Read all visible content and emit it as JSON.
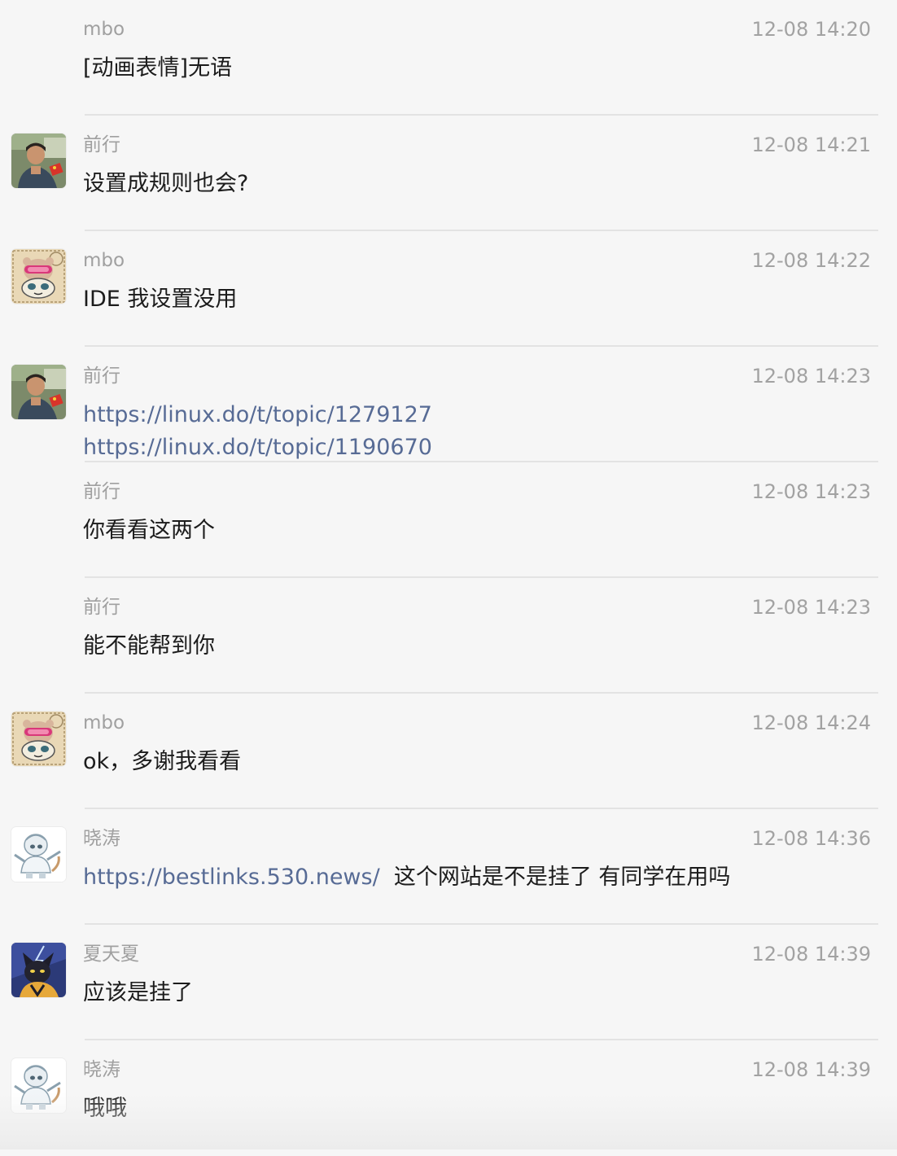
{
  "messages": [
    {
      "sender": "mbo",
      "time": "12-08 14:20",
      "avatar": "none",
      "lines": [
        [
          {
            "text": "[动画表情]无语",
            "kind": "text"
          }
        ]
      ]
    },
    {
      "sender": "前行",
      "time": "12-08 14:21",
      "avatar": "photo-avatar",
      "lines": [
        [
          {
            "text": "设置成规则也会?",
            "kind": "text"
          }
        ]
      ]
    },
    {
      "sender": "mbo",
      "time": "12-08 14:22",
      "avatar": "cartoon-bear-avatar",
      "lines": [
        [
          {
            "text": "IDE 我设置没用",
            "kind": "text"
          }
        ]
      ]
    },
    {
      "sender": "前行",
      "time": "12-08 14:23",
      "avatar": "photo-avatar",
      "lines": [
        [
          {
            "text": "https://linux.do/t/topic/1279127",
            "kind": "link"
          }
        ],
        [
          {
            "text": "https://linux.do/t/topic/1190670",
            "kind": "link"
          }
        ]
      ]
    },
    {
      "sender": "前行",
      "time": "12-08 14:23",
      "avatar": "none",
      "lines": [
        [
          {
            "text": "你看看这两个",
            "kind": "text"
          }
        ]
      ]
    },
    {
      "sender": "前行",
      "time": "12-08 14:23",
      "avatar": "none",
      "lines": [
        [
          {
            "text": "能不能帮到你",
            "kind": "text"
          }
        ]
      ]
    },
    {
      "sender": "mbo",
      "time": "12-08 14:24",
      "avatar": "cartoon-bear-avatar",
      "lines": [
        [
          {
            "text": "ok，多谢我看看",
            "kind": "text"
          }
        ]
      ]
    },
    {
      "sender": "晓涛",
      "time": "12-08 14:36",
      "avatar": "astronaut-cat-avatar",
      "lines": [
        [
          {
            "text": "https://bestlinks.530.news/",
            "kind": "link"
          },
          {
            "text": "  这个网站是不是挂了 有同学在用吗",
            "kind": "text"
          }
        ]
      ]
    },
    {
      "sender": "夏天夏",
      "time": "12-08 14:39",
      "avatar": "dark-cat-avatar",
      "lines": [
        [
          {
            "text": "应该是挂了",
            "kind": "text"
          }
        ]
      ]
    },
    {
      "sender": "晓涛",
      "time": "12-08 14:39",
      "avatar": "astronaut-cat-avatar",
      "lines": [
        [
          {
            "text": "哦哦",
            "kind": "text"
          }
        ]
      ]
    }
  ],
  "colors": {
    "background": "#f6f6f6",
    "sender": "#a0a0a0",
    "time": "#a2a2a2",
    "text": "#1c1c1c",
    "link": "#576b95",
    "divider": "#e3e3e3"
  }
}
